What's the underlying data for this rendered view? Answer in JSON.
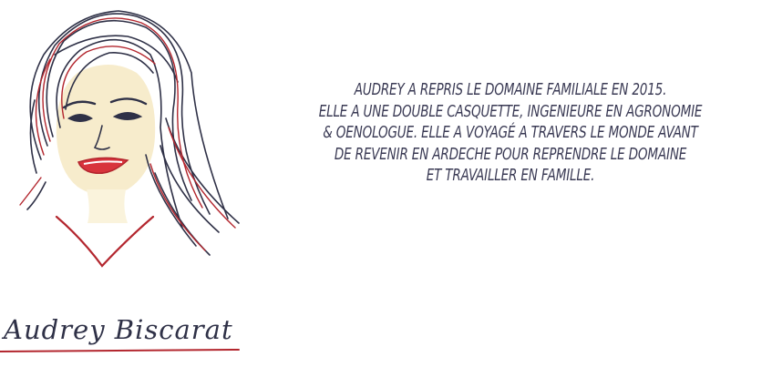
{
  "bio": {
    "lines": [
      "AUDREY A REPRIS LE DOMAINE FAMILIALE EN 2015.",
      "ELLE A UNE DOUBLE CASQUETTE, INGENIEURE EN AGRONOMIE",
      "& OENOLOGUE.  ELLE A VOYAGÉ A TRAVERS LE MONDE AVANT",
      "DE REVENIR EN ARDECHE POUR REPRENDRE LE DOMAINE",
      "ET TRAVAILLER EN FAMILLE."
    ]
  },
  "signature": {
    "text": "Audrey Biscarat"
  },
  "colors": {
    "ink": "#2f3147",
    "red": "#b3262e",
    "skin": "#f7eccc",
    "text": "#3a3a54"
  }
}
